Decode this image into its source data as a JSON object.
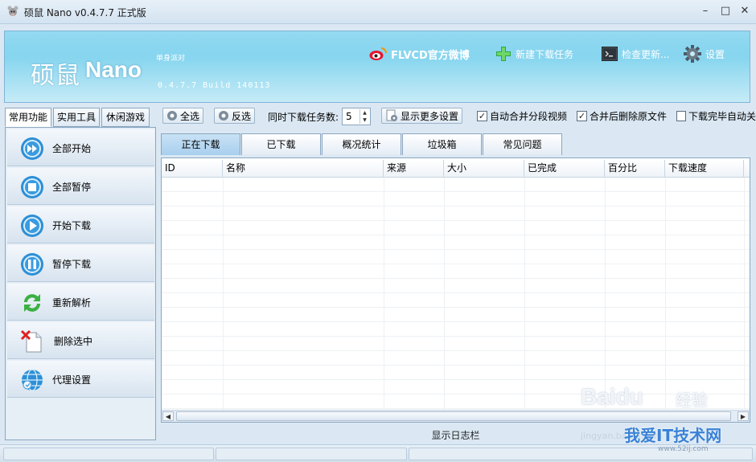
{
  "window": {
    "title": "硕鼠 Nano v0.4.7.7 正式版",
    "minimize": "–",
    "maximize": "□",
    "close": "✕"
  },
  "banner": {
    "logo_cn": "硕鼠",
    "logo_en": "Nano",
    "slogan": "单身派对",
    "version_line": "0.4.7.7 Build 140113",
    "links": {
      "weibo": "FLVCD官方微博",
      "new_task": "新建下载任务",
      "check_update": "检查更新...",
      "settings": "设置"
    }
  },
  "left_tabs": [
    "常用功能",
    "实用工具",
    "休闲游戏"
  ],
  "side_buttons": [
    "全部开始",
    "全部暂停",
    "开始下载",
    "暂停下载",
    "重新解析",
    "删除选中",
    "代理设置"
  ],
  "toolbar": {
    "select_all": "全选",
    "invert": "反选",
    "concurrent_label": "同时下载任务数:",
    "concurrent_value": "5",
    "more_settings": "显示更多设置",
    "checks": [
      {
        "label": "自动合并分段视频",
        "checked": true
      },
      {
        "label": "合并后删除原文件",
        "checked": true
      },
      {
        "label": "下载完毕自动关",
        "checked": false
      }
    ]
  },
  "main_tabs": [
    "正在下载",
    "已下载",
    "概况统计",
    "垃圾箱",
    "常见问题"
  ],
  "grid": {
    "columns": [
      "ID",
      "名称",
      "来源",
      "大小",
      "已完成",
      "百分比",
      "下载速度"
    ]
  },
  "log_bar": "显示日志栏",
  "watermark": {
    "baidu": "Baidu",
    "jingyan_mark": "经验",
    "jingyan_url": "jingyan.baidu.com",
    "site": "我爱IT技术网",
    "url": "www.52ij.com"
  },
  "colors": {
    "banner_top": "#5dc6ea",
    "banner_bottom": "#c6ebf7",
    "active_tab": "#a8cfee",
    "frame": "#dbe8f3"
  }
}
